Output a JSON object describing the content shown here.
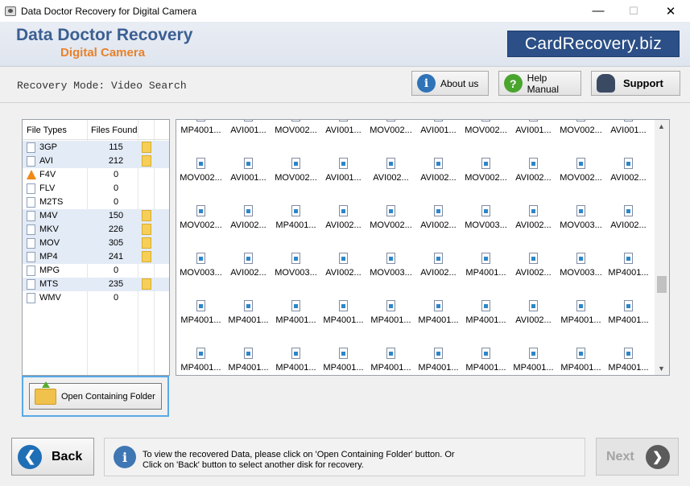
{
  "window": {
    "title": "Data Doctor Recovery for Digital Camera",
    "minimize": "—",
    "maximize": "☐",
    "close": "✕"
  },
  "header": {
    "brand_line1": "Data Doctor Recovery",
    "brand_line2": "Digital Camera",
    "site": "CardRecovery.biz"
  },
  "mode_text": "Recovery Mode: Video Search",
  "buttons": {
    "about": "About us",
    "help": "Help Manual",
    "support": "Support",
    "open_folder": "Open Containing Folder",
    "back": "Back",
    "next": "Next"
  },
  "file_table": {
    "col_types": "File Types",
    "col_found": "Files Found",
    "rows": [
      {
        "type": "3GP",
        "count": "115",
        "has_folder": true
      },
      {
        "type": "AVI",
        "count": "212",
        "has_folder": true
      },
      {
        "type": "F4V",
        "count": "0",
        "has_folder": false
      },
      {
        "type": "FLV",
        "count": "0",
        "has_folder": false
      },
      {
        "type": "M2TS",
        "count": "0",
        "has_folder": false
      },
      {
        "type": "M4V",
        "count": "150",
        "has_folder": true
      },
      {
        "type": "MKV",
        "count": "226",
        "has_folder": true
      },
      {
        "type": "MOV",
        "count": "305",
        "has_folder": true
      },
      {
        "type": "MP4",
        "count": "241",
        "has_folder": true
      },
      {
        "type": "MPG",
        "count": "0",
        "has_folder": false
      },
      {
        "type": "MTS",
        "count": "235",
        "has_folder": true
      },
      {
        "type": "WMV",
        "count": "0",
        "has_folder": false
      }
    ]
  },
  "grid_rows": [
    [
      "MP4001...",
      "AVI001...",
      "MOV002...",
      "AVI001...",
      "MOV002...",
      "AVI001...",
      "MOV002...",
      "AVI001...",
      "MOV002...",
      "AVI001..."
    ],
    [
      "MOV002...",
      "AVI001...",
      "MOV002...",
      "AVI001...",
      "AVI002...",
      "AVI002...",
      "MOV002...",
      "AVI002...",
      "MOV002...",
      "AVI002..."
    ],
    [
      "MOV002...",
      "AVI002...",
      "MP4001...",
      "AVI002...",
      "MOV002...",
      "AVI002...",
      "MOV003...",
      "AVI002...",
      "MOV003...",
      "AVI002..."
    ],
    [
      "MOV003...",
      "AVI002...",
      "MOV003...",
      "AVI002...",
      "MOV003...",
      "AVI002...",
      "MP4001...",
      "AVI002...",
      "MOV003...",
      "MP4001..."
    ],
    [
      "MP4001...",
      "MP4001...",
      "MP4001...",
      "MP4001...",
      "MP4001...",
      "MP4001...",
      "MP4001...",
      "AVI002...",
      "MP4001...",
      "MP4001..."
    ],
    [
      "MP4001...",
      "MP4001...",
      "MP4001...",
      "MP4001...",
      "MP4001...",
      "MP4001...",
      "MP4001...",
      "MP4001...",
      "MP4001...",
      "MP4001..."
    ]
  ],
  "info": {
    "line1": "To view the recovered Data, please click on 'Open Containing Folder' button. Or",
    "line2": "Click on 'Back' button to select another disk for recovery."
  },
  "colors": {
    "brand_blue": "#3b5f92",
    "brand_orange": "#e8812c",
    "site_bg": "#2b4f86"
  }
}
